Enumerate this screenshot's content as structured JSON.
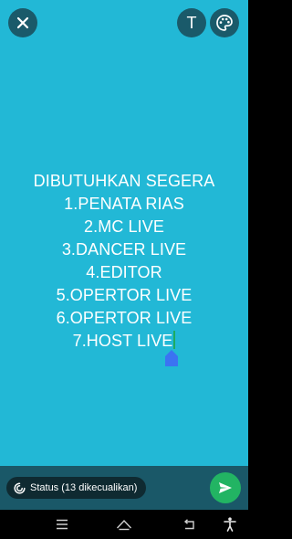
{
  "status_text": {
    "lines": [
      "DIBUTUHKAN SEGERA",
      "1.PENATA RIAS",
      "2.MC LIVE",
      "3.DANCER LIVE",
      "4.EDITOR",
      "5.OPERTOR LIVE",
      "6.OPERTOR LIVE",
      "7.HOST LIVE"
    ],
    "text_color": "#ffffff"
  },
  "toolbar": {
    "close_icon": "close-icon",
    "text_button_glyph": "T",
    "palette_icon": "palette-icon"
  },
  "footer": {
    "privacy_label": "Status (13 dikecualikan)",
    "privacy_icon": "status-privacy-icon",
    "send_icon": "send-icon"
  },
  "colors": {
    "background": "#22b8d6",
    "footer_background": "#1a5868",
    "send_button": "#22b463",
    "cursor": "#1dab60",
    "drag_handle": "#3b73f2"
  },
  "navigation": {
    "items": [
      "menu-icon",
      "home-icon",
      "back-icon",
      "accessibility-icon"
    ]
  }
}
